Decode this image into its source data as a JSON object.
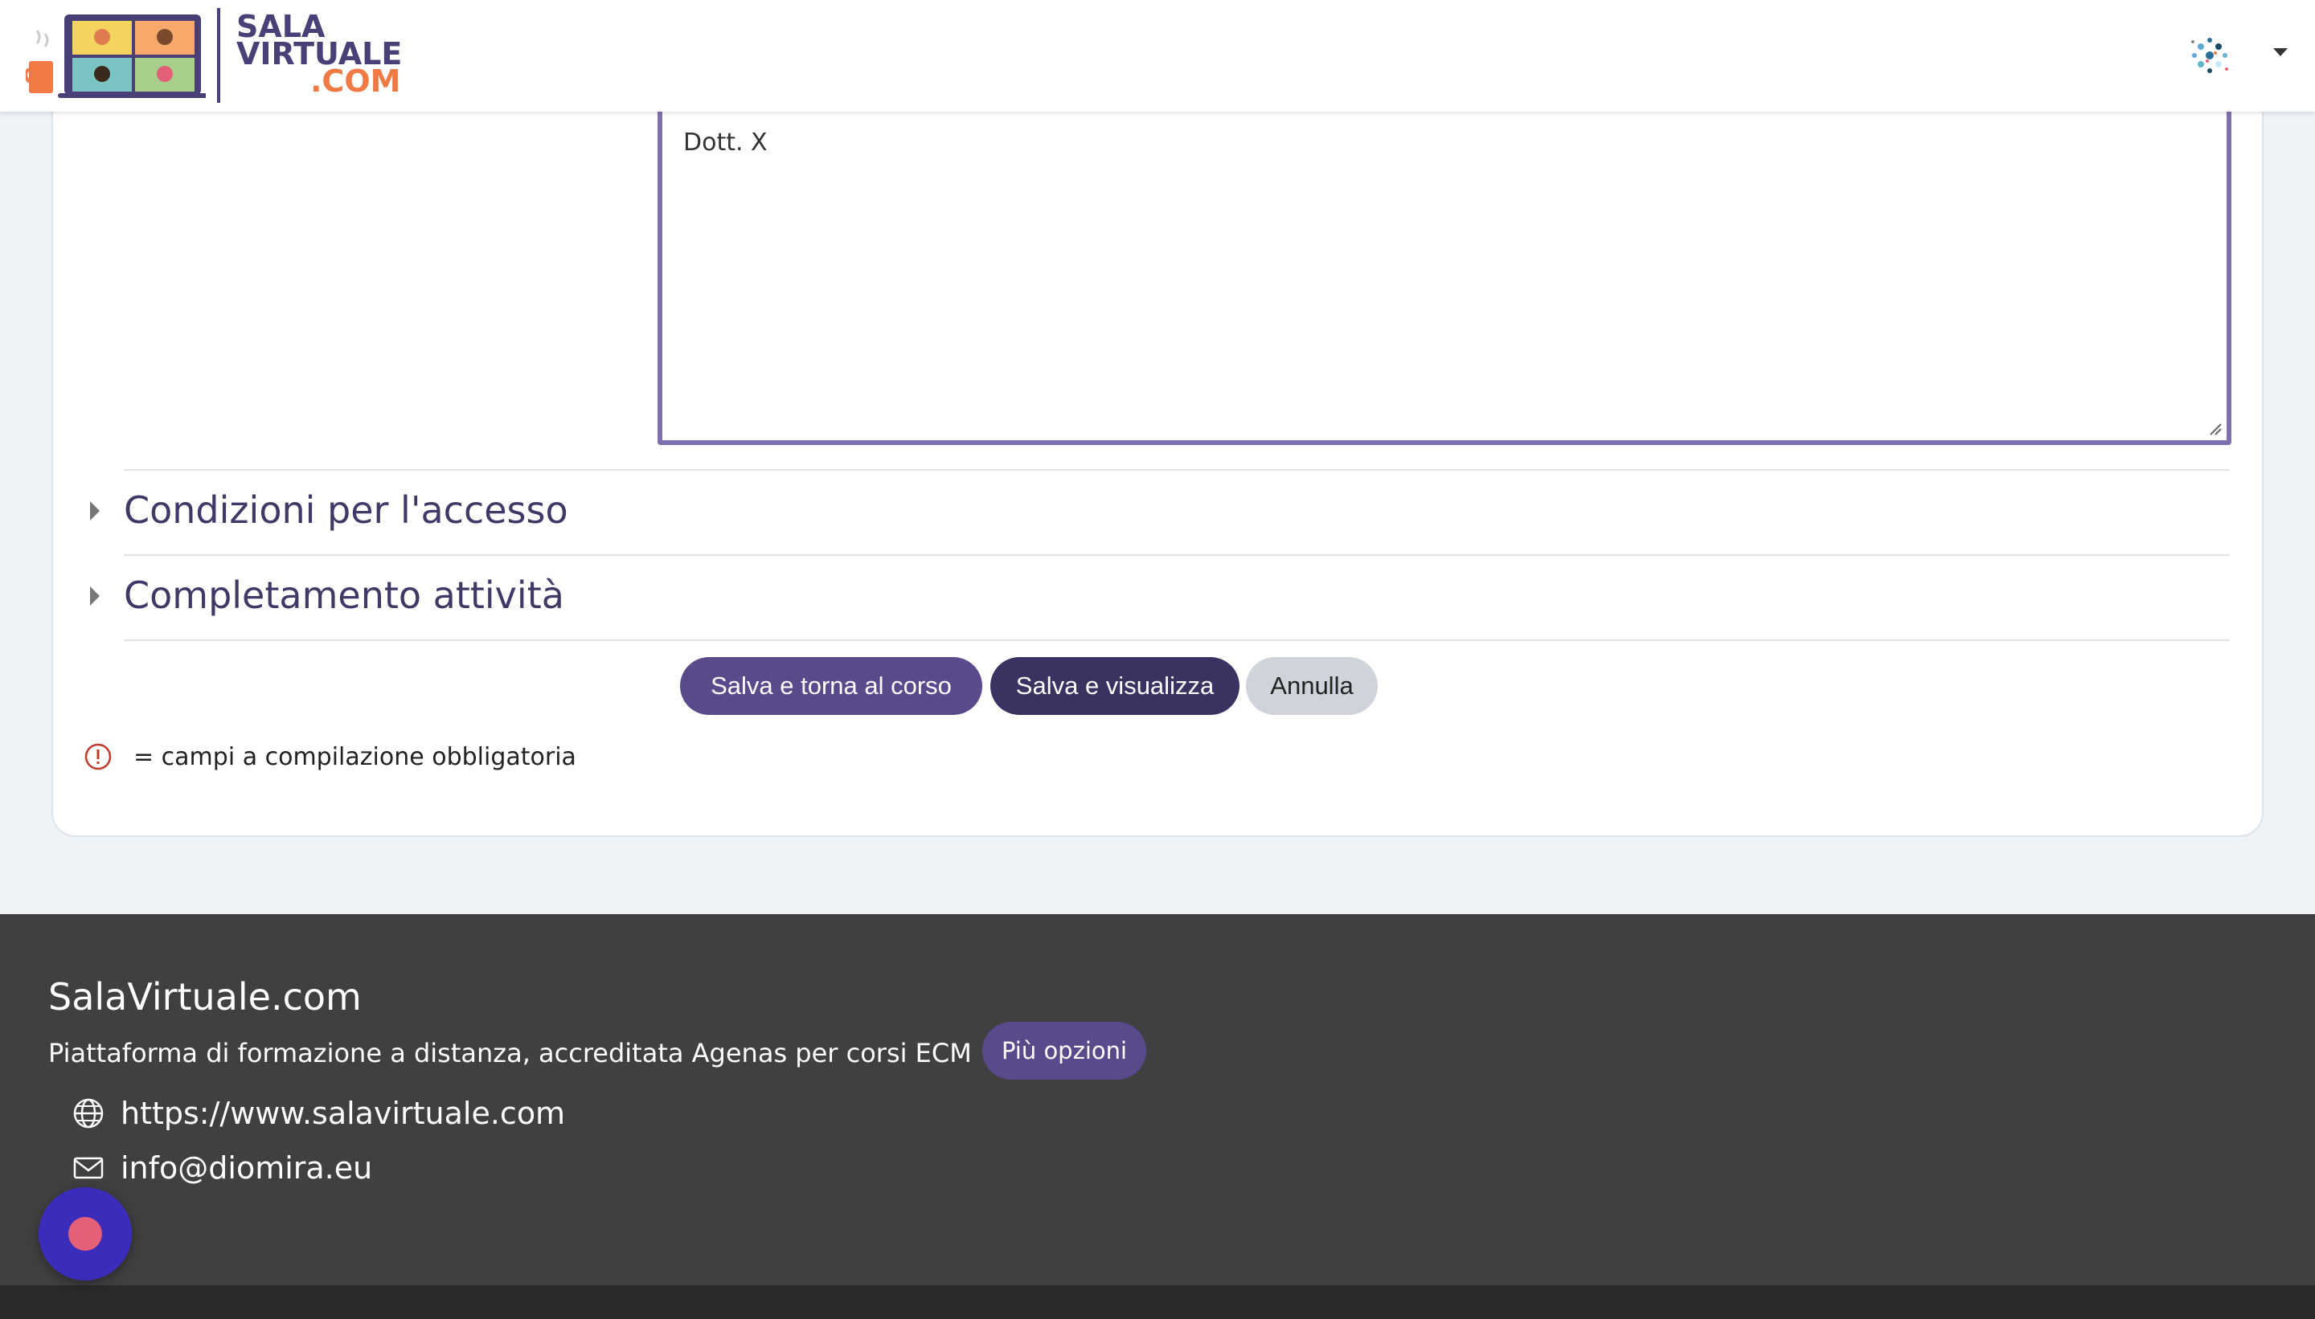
{
  "header": {
    "logo_line1": "SALA",
    "logo_line2": "VIRTUALE",
    "logo_line3": ".COM",
    "user_menu_icon": "caret-down-icon"
  },
  "form": {
    "textarea_value": "Dott. X",
    "sections": [
      {
        "title": "Condizioni per l'accesso"
      },
      {
        "title": "Completamento attività"
      }
    ],
    "buttons": {
      "save_return": "Salva e torna al corso",
      "save_view": "Salva e visualizza",
      "cancel": "Annulla"
    },
    "required_note": "= campi a compilazione obbligatoria"
  },
  "footer": {
    "site_name": "SalaVirtuale.com",
    "tagline": "Piattaforma di formazione a distanza, accreditata Agenas per corsi ECM",
    "more_button": "Più opzioni",
    "website": "https://www.salavirtuale.com",
    "email": "info@diomira.eu"
  },
  "colors": {
    "brand_purple": "#5b4a8b",
    "brand_orange": "#f07a45",
    "footer_bg": "#403f41",
    "fab_bg": "#3b2dbb",
    "fab_dot": "#e46079"
  }
}
